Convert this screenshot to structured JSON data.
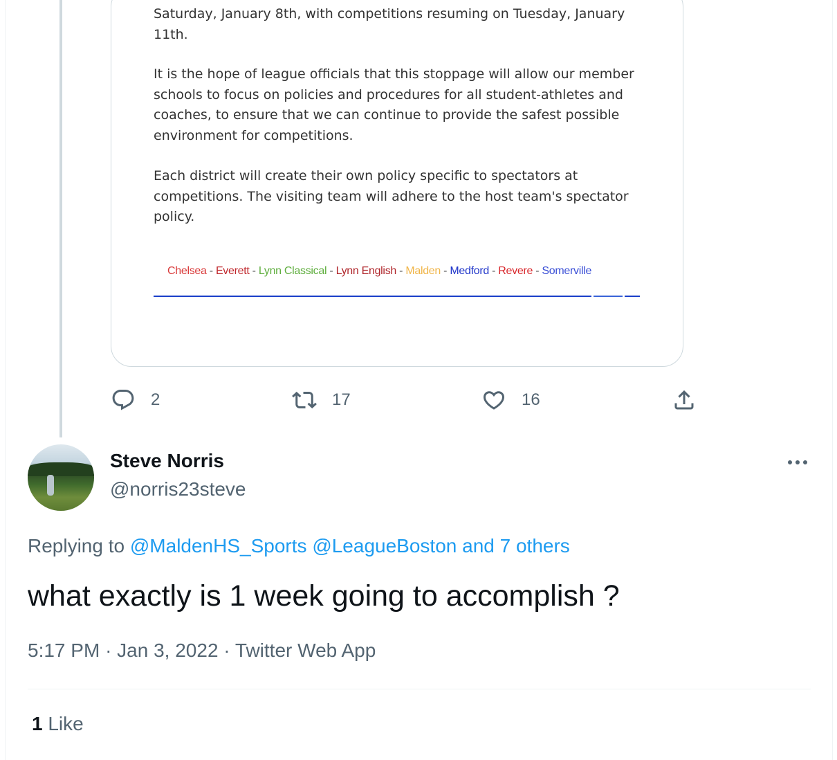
{
  "embedded_document": {
    "paragraph_1": "Saturday, January 8th, with competitions resuming on Tuesday, January 11th.",
    "paragraph_2": "It is the hope of league officials that this stoppage will allow our member schools to focus on policies and procedures for all student-athletes and coaches, to ensure that we can continue to provide the safest possible environment for competitions.",
    "paragraph_3": "Each district will create their own policy specific to spectators at competitions. The visiting team will adhere to the host team's spectator policy.",
    "schools": [
      {
        "name": "Chelsea",
        "color": "#d93a3a"
      },
      {
        "name": "Everett",
        "color": "#c0282d"
      },
      {
        "name": "Lynn Classical",
        "color": "#5fae3e"
      },
      {
        "name": "Lynn English",
        "color": "#b0272c"
      },
      {
        "name": "Malden",
        "color": "#f0b548"
      },
      {
        "name": "Medford",
        "color": "#1f35c9"
      },
      {
        "name": "Revere",
        "color": "#d8262b"
      },
      {
        "name": "Somerville",
        "color": "#3a4fd6"
      }
    ],
    "separator": "-"
  },
  "parent_tweet_actions": {
    "reply_count": "2",
    "retweet_count": "17",
    "like_count": "16"
  },
  "reply_tweet": {
    "author_name": "Steve Norris",
    "author_handle": "@norris23steve",
    "replying_prefix": "Replying to",
    "replying_to": [
      "@MaldenHS_Sports",
      "@LeagueBoston",
      "and 7 others"
    ],
    "text": "what exactly is 1 week going to accomplish ?",
    "time": "5:17 PM",
    "date": "Jan 3, 2022",
    "source": "Twitter Web App",
    "meta_separator": "·",
    "like_total": "1",
    "like_label": "Like"
  },
  "icons": {
    "reply": "reply-icon",
    "retweet": "retweet-icon",
    "like": "heart-icon",
    "share": "share-icon",
    "more": "more-icon"
  },
  "colors": {
    "link": "#1d9bf0",
    "secondary_text": "#536471",
    "primary_text": "#0f1419",
    "thread_line": "#cfd9de"
  }
}
